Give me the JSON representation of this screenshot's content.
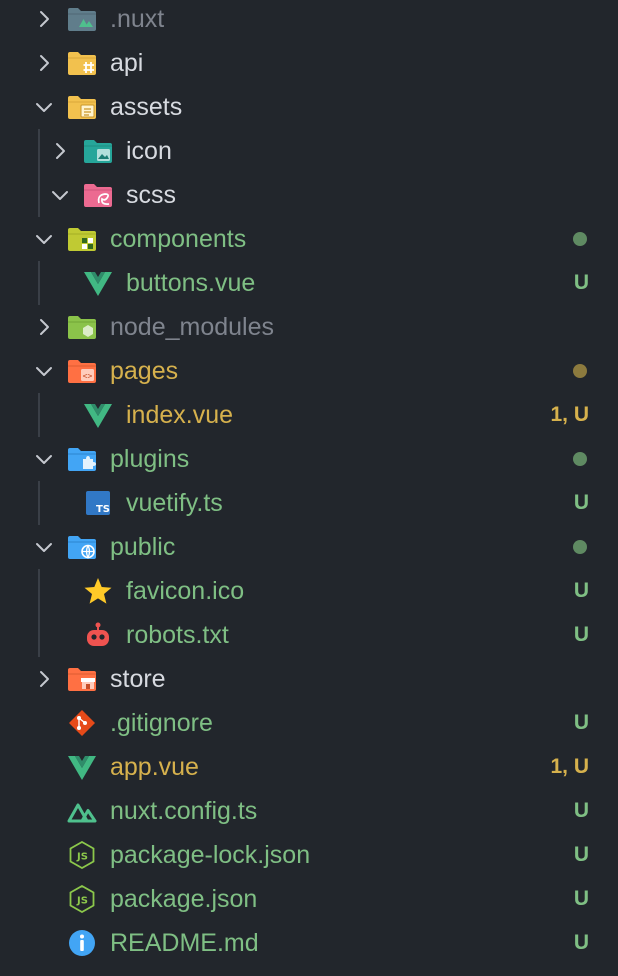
{
  "explorer": {
    "items": [
      {
        "label": ".nuxt",
        "icon": "nuxt-folder-icon",
        "chevron": "right",
        "depth": 0,
        "state": "ignored"
      },
      {
        "label": "api",
        "icon": "api-folder-icon",
        "chevron": "right",
        "depth": 0,
        "state": "default"
      },
      {
        "label": "assets",
        "icon": "assets-folder-open-icon",
        "chevron": "down",
        "depth": 0,
        "state": "default"
      },
      {
        "label": "icon",
        "icon": "images-folder-icon",
        "chevron": "right",
        "depth": 1,
        "state": "default"
      },
      {
        "label": "scss",
        "icon": "sass-folder-open-icon",
        "chevron": "down",
        "depth": 1,
        "state": "default"
      },
      {
        "label": "components",
        "icon": "components-folder-open-icon",
        "chevron": "down",
        "depth": 0,
        "state": "new",
        "dot": "#5f8a62"
      },
      {
        "label": "buttons.vue",
        "icon": "vue-icon",
        "depth": 1,
        "state": "new",
        "badge": "U"
      },
      {
        "label": "node_modules",
        "icon": "node-modules-folder-icon",
        "chevron": "right",
        "depth": 0,
        "state": "ignored"
      },
      {
        "label": "pages",
        "icon": "pages-folder-open-icon",
        "chevron": "down",
        "depth": 0,
        "state": "mod",
        "dot": "#8c7a3e"
      },
      {
        "label": "index.vue",
        "icon": "vue-icon",
        "depth": 1,
        "state": "mod",
        "badge": "1, U"
      },
      {
        "label": "plugins",
        "icon": "plugins-folder-open-icon",
        "chevron": "down",
        "depth": 0,
        "state": "new",
        "dot": "#5f8a62"
      },
      {
        "label": "vuetify.ts",
        "icon": "typescript-icon",
        "depth": 1,
        "state": "new",
        "badge": "U"
      },
      {
        "label": "public",
        "icon": "public-folder-open-icon",
        "chevron": "down",
        "depth": 0,
        "state": "new",
        "dot": "#5f8a62"
      },
      {
        "label": "favicon.ico",
        "icon": "star-icon",
        "depth": 1,
        "state": "new",
        "badge": "U"
      },
      {
        "label": "robots.txt",
        "icon": "robot-icon",
        "depth": 1,
        "state": "new",
        "badge": "U"
      },
      {
        "label": "store",
        "icon": "store-folder-icon",
        "chevron": "right",
        "depth": 0,
        "state": "default"
      },
      {
        "label": ".gitignore",
        "icon": "git-icon",
        "depth": 0,
        "state": "new",
        "badge": "U"
      },
      {
        "label": "app.vue",
        "icon": "vue-icon",
        "depth": 0,
        "state": "mod",
        "badge": "1, U"
      },
      {
        "label": "nuxt.config.ts",
        "icon": "nuxt-icon",
        "depth": 0,
        "state": "new",
        "badge": "U"
      },
      {
        "label": "package-lock.json",
        "icon": "nodejs-icon",
        "depth": 0,
        "state": "new",
        "badge": "U"
      },
      {
        "label": "package.json",
        "icon": "nodejs-icon",
        "depth": 0,
        "state": "new",
        "badge": "U"
      },
      {
        "label": "README.md",
        "icon": "info-icon",
        "depth": 0,
        "state": "new",
        "badge": "U"
      }
    ]
  },
  "colors": {
    "background": "#22262c",
    "untracked": "#7fbf84",
    "modified": "#d6b14d",
    "ignored": "#7f848e",
    "default": "#d7dae0"
  }
}
